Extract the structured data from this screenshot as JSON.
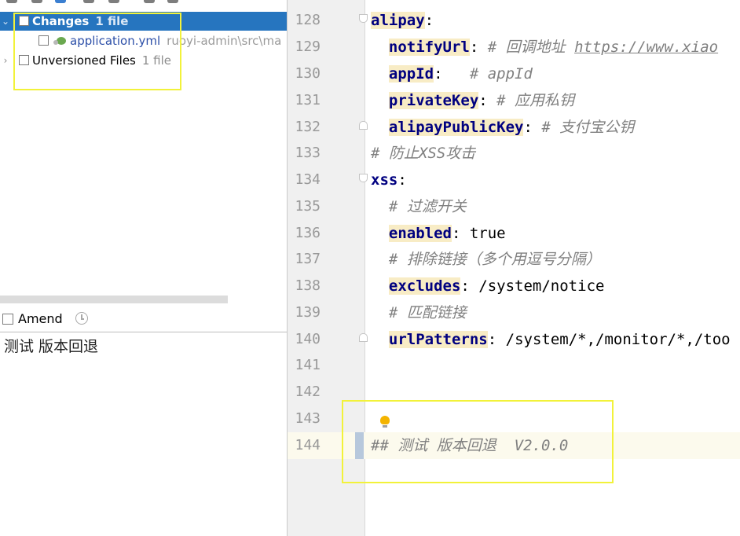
{
  "changes_panel": {
    "groups": [
      {
        "label": "Changes",
        "count": "1 file",
        "expanded": true,
        "selected": true,
        "files": [
          {
            "name": "application.yml",
            "path": "ruoyi-admin\\src\\ma"
          }
        ]
      },
      {
        "label": "Unversioned Files",
        "count": "1 file",
        "expanded": false,
        "selected": false
      }
    ]
  },
  "commit": {
    "amend_label": "Amend",
    "message": "测试 版本回退"
  },
  "editor": {
    "lines": [
      {
        "n": "128"
      },
      {
        "n": "129"
      },
      {
        "n": "130"
      },
      {
        "n": "131"
      },
      {
        "n": "132"
      },
      {
        "n": "133"
      },
      {
        "n": "134"
      },
      {
        "n": "135"
      },
      {
        "n": "136"
      },
      {
        "n": "137"
      },
      {
        "n": "138"
      },
      {
        "n": "139"
      },
      {
        "n": "140"
      },
      {
        "n": "141"
      },
      {
        "n": "142"
      },
      {
        "n": "143"
      },
      {
        "n": "144"
      }
    ],
    "code": {
      "l128_key": "alipay",
      "l129_key": "notifyUrl",
      "l129_comment": "# 回调地址 ",
      "l129_url": "https://www.xiao",
      "l130_key": "appId",
      "l130_comment": "# appId",
      "l131_key": "privateKey",
      "l131_comment": "# 应用私钥",
      "l132_key": "alipayPublicKey",
      "l132_comment": "# 支付宝公钥",
      "l133_comment": "# 防止XSS攻击",
      "l134_key": "xss",
      "l135_comment": "# 过滤开关",
      "l136_key": "enabled",
      "l136_value": "true",
      "l137_comment": "# 排除链接（多个用逗号分隔）",
      "l138_key": "excludes",
      "l138_value": "/system/notice",
      "l139_comment": "# 匹配链接",
      "l140_key": "urlPatterns",
      "l140_value": "/system/*,/monitor/*,/too",
      "l144_comment": "## 测试 版本回退  V2.0.0"
    }
  },
  "colors": {
    "selection": "#2675bf",
    "key": "#000080",
    "comment": "#808080",
    "annotation": "#f2f23a"
  }
}
